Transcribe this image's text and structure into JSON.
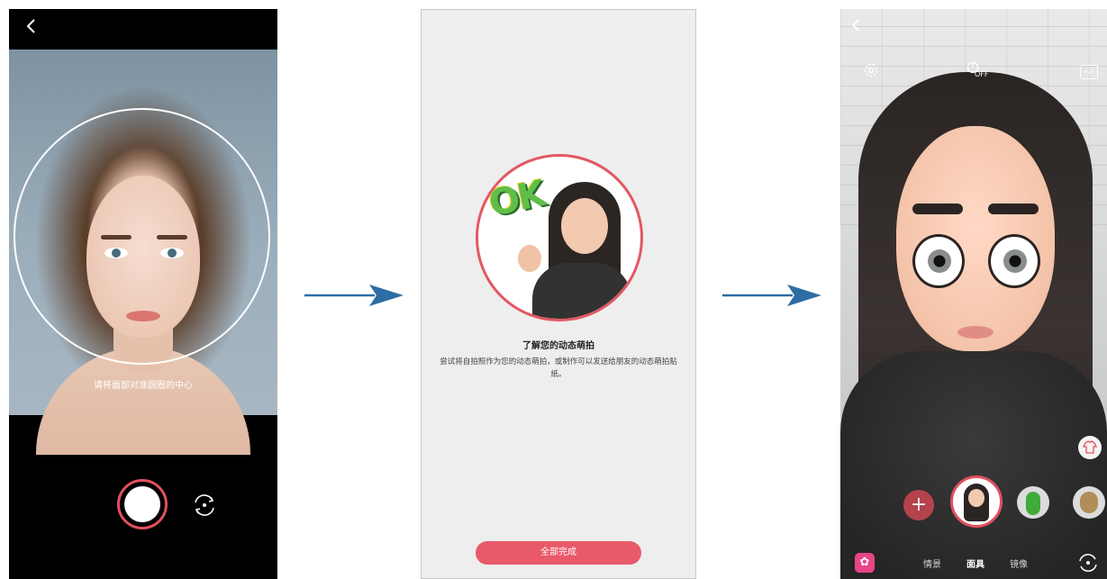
{
  "screen1": {
    "back_icon": "chevron-left-icon",
    "hint": "请将面部对准圆圈的中心",
    "shutter_color": "#e0505e"
  },
  "screen2": {
    "badge_text": "OK",
    "title": "了解您的动态萌拍",
    "description": "尝试将自拍照作为您的动态萌拍，或制作可以发送给朋友的动态萌拍贴纸。",
    "done_button": "全部完成",
    "accent": "#e85a6a"
  },
  "screen3": {
    "timer_label": "OFF",
    "full_label": "Full",
    "plus_label": "+",
    "modes": [
      "情景",
      "面具",
      "镜像"
    ],
    "active_mode": "面具",
    "accent": "#e0505e"
  }
}
